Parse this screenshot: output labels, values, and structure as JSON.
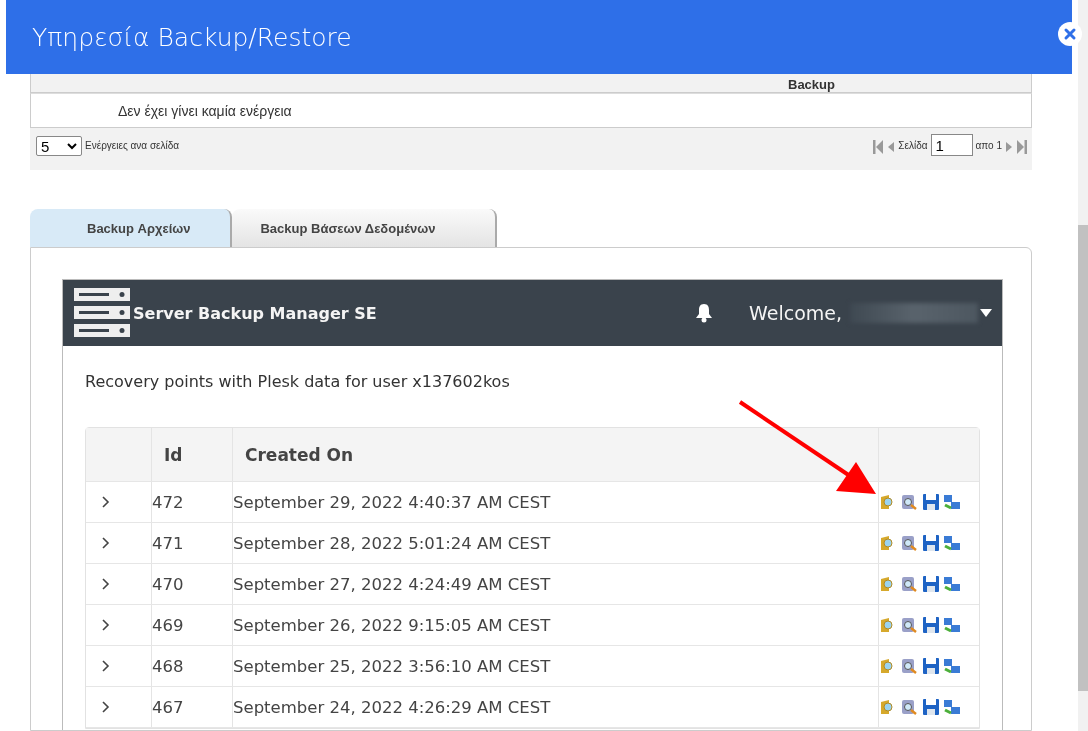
{
  "window": {
    "title": "Υπηρεσία Backup/Restore"
  },
  "history_table": {
    "columns": [
      "Backup"
    ],
    "empty_message": "Δεν έχει γίνει καμία ενέργεια",
    "pager": {
      "page_size": "5",
      "page_size_label": "Ενέργειες ανα σελίδα",
      "page_label": "Σελίδα",
      "page": "1",
      "of_label": "απο 1"
    }
  },
  "tabs": [
    {
      "label": "Backup Αρχείων",
      "selected": true
    },
    {
      "label": "Backup Βάσεων Δεδομένων",
      "selected": false
    }
  ],
  "app": {
    "title": "Server Backup Manager SE",
    "welcome": "Welcome,",
    "subtitle": "Recovery points with Plesk data for user x137602kos",
    "columns": [
      "Id",
      "Created On"
    ],
    "rows": [
      {
        "id": "472",
        "created": "September 29, 2022 4:40:37 AM CEST"
      },
      {
        "id": "471",
        "created": "September 28, 2022 5:01:24 AM CEST"
      },
      {
        "id": "470",
        "created": "September 27, 2022 4:24:49 AM CEST"
      },
      {
        "id": "469",
        "created": "September 26, 2022 9:15:05 AM CEST"
      },
      {
        "id": "468",
        "created": "September 25, 2022 3:56:10 AM CEST"
      },
      {
        "id": "467",
        "created": "September 24, 2022 4:26:29 AM CEST"
      }
    ]
  }
}
